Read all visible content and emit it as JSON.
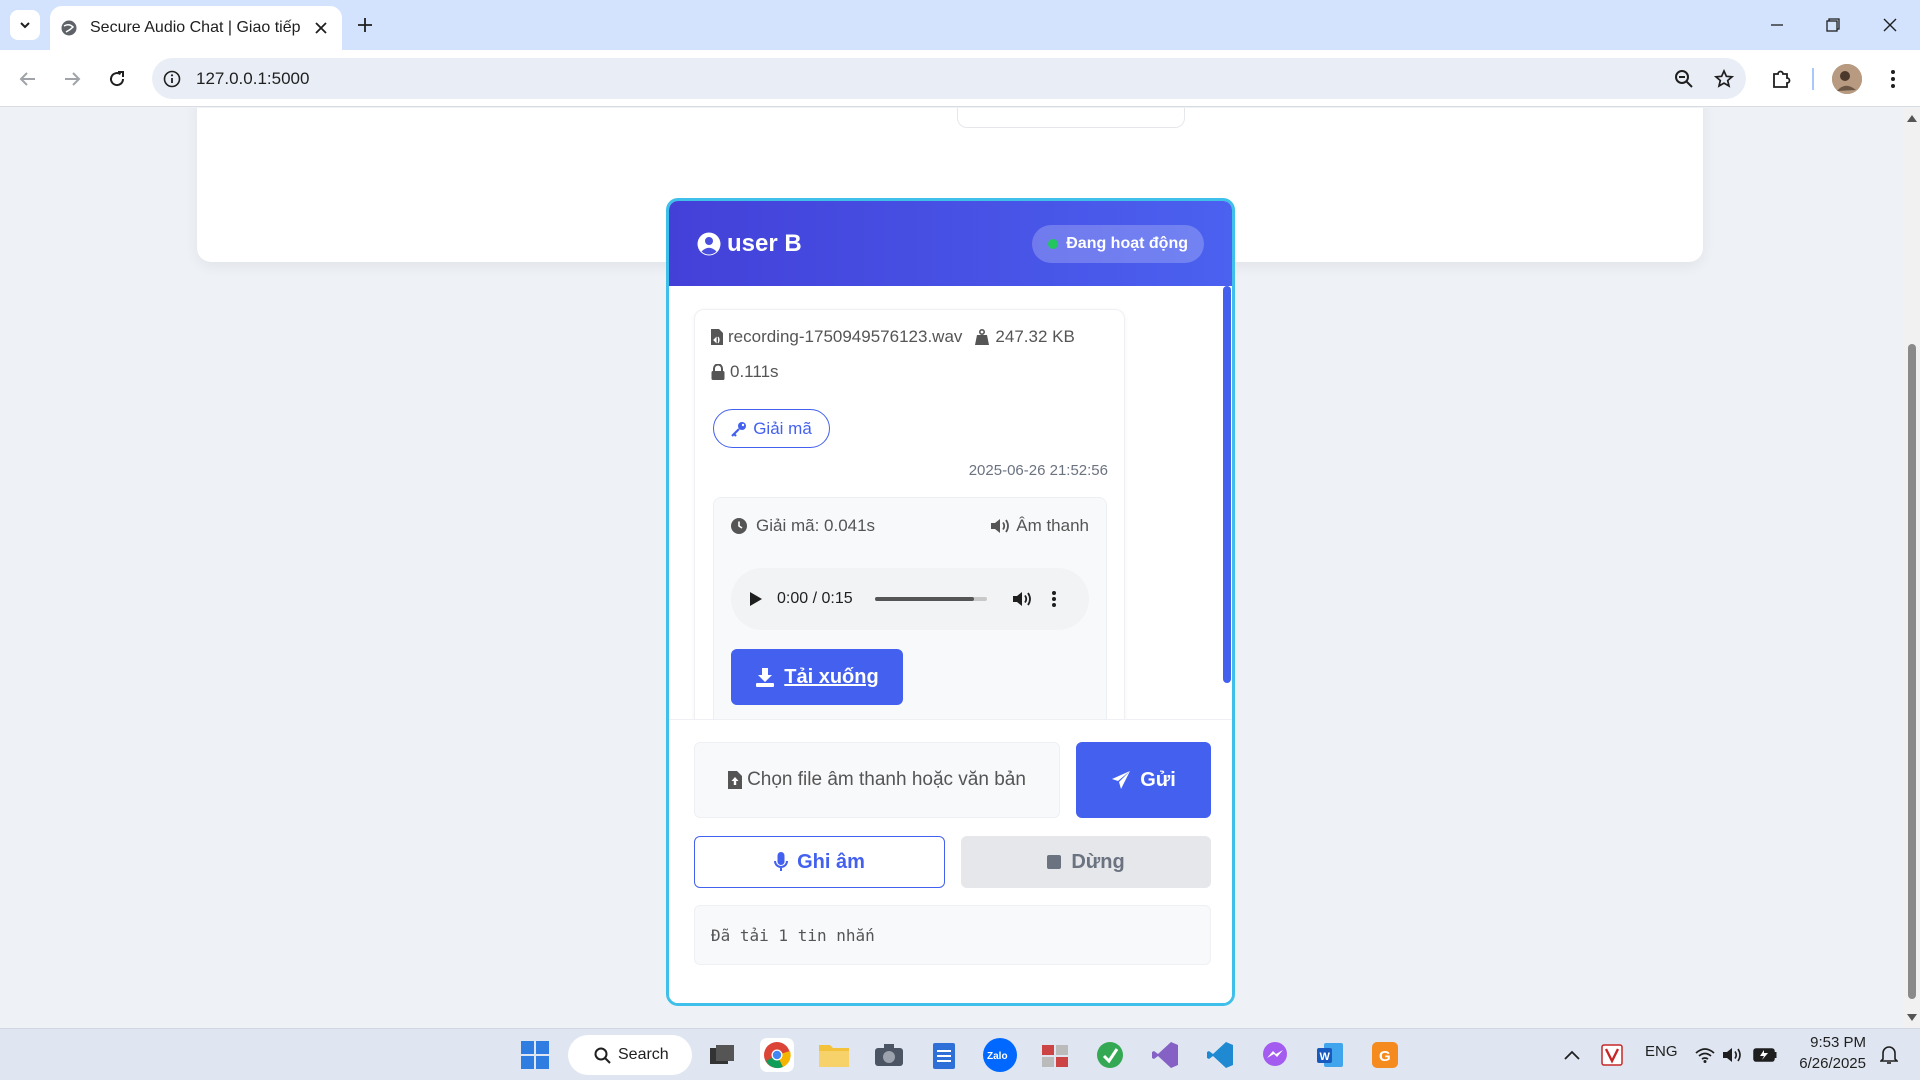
{
  "browser": {
    "tab_title": "Secure Audio Chat | Giao tiếp b",
    "url": "127.0.0.1:5000"
  },
  "chat": {
    "user_name": "user B",
    "status": "Đang hoạt động",
    "message": {
      "file_name": "recording-1750949576123.wav",
      "file_size": "247.32 KB",
      "encrypt_time": "0.111s",
      "decrypt_button": "Giải mã",
      "timestamp": "2025-06-26 21:52:56",
      "decrypt_time": "Giải mã: 0.041s",
      "audio_label": "Âm thanh",
      "player_time": "0:00 / 0:15",
      "player_progress": 0.88,
      "download_button": "Tải xuống"
    },
    "composer": {
      "file_placeholder": "Chọn file âm thanh hoặc văn bản",
      "send_button": "Gửi",
      "record_button": "Ghi âm",
      "stop_button": "Dừng",
      "log_text": "Đã tải 1 tin nhắn"
    }
  },
  "taskbar": {
    "search_label": "Search",
    "lang": "ENG",
    "time": "9:53 PM",
    "date": "6/26/2025"
  },
  "colors": {
    "accent": "#4361ee",
    "header_start": "#4340d8",
    "border": "#3fc0ea",
    "status_dot": "#22c55e"
  }
}
